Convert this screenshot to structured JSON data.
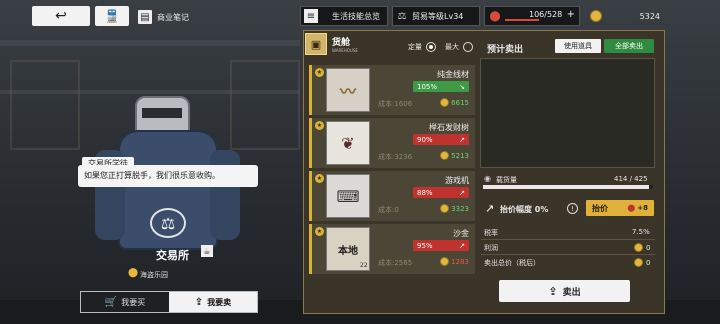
{
  "top_bar": {
    "notes_label": "商业笔记",
    "guide_label": "生活技能总览",
    "trade_level": "贸易等级Lv34",
    "stamina_value": "106/528",
    "stamina_plus": "+",
    "coin_value": "5324"
  },
  "dialog": {
    "speaker": "交易所学徒",
    "text": "如果您正打算脱手，我们很乐意收购。"
  },
  "shop": {
    "name": "交易所",
    "location": "海盗乐园"
  },
  "tabs": [
    {
      "label": "我要买"
    },
    {
      "label": "我要卖"
    }
  ],
  "cargo": {
    "title": "货舱",
    "subtitle": "WAREHOUSE",
    "option_fixed": "定量",
    "option_max": "最大"
  },
  "items": [
    {
      "name": "纯金线材",
      "percent": "105%",
      "cost": "成本:1606",
      "price": "6615",
      "thumb": "",
      "qty": ""
    },
    {
      "name": "榉石发财树",
      "percent": "90%",
      "cost": "成本:3236",
      "price": "5213",
      "thumb": "",
      "qty": ""
    },
    {
      "name": "游戏机",
      "percent": "88%",
      "cost": "成本:0",
      "price": "3323",
      "thumb": "",
      "qty": ""
    },
    {
      "name": "沙金",
      "percent": "95%",
      "cost": "成本:2565",
      "price": "1283",
      "thumb": "本地",
      "qty": "22"
    }
  ],
  "sell_panel": {
    "title": "预计卖出",
    "use_item_label": "使用道具",
    "sell_all_label": "全部卖出",
    "load_label": "载货量",
    "load_value": "414 / 425",
    "load_fraction": 0.974,
    "raise_label": "抬价幅度 0%",
    "raise_button": "抬价",
    "raise_bonus": "+8",
    "tax_label": "税率",
    "tax_value": "7.5%",
    "profit_label": "利润",
    "profit_value": "0",
    "total_label": "卖出总价（税后）",
    "total_value": "0",
    "sell_button": "卖出"
  },
  "colors": {
    "accent_gold": "#d8b438",
    "up_green": "#3f9a46",
    "down_red": "#c0322d"
  }
}
